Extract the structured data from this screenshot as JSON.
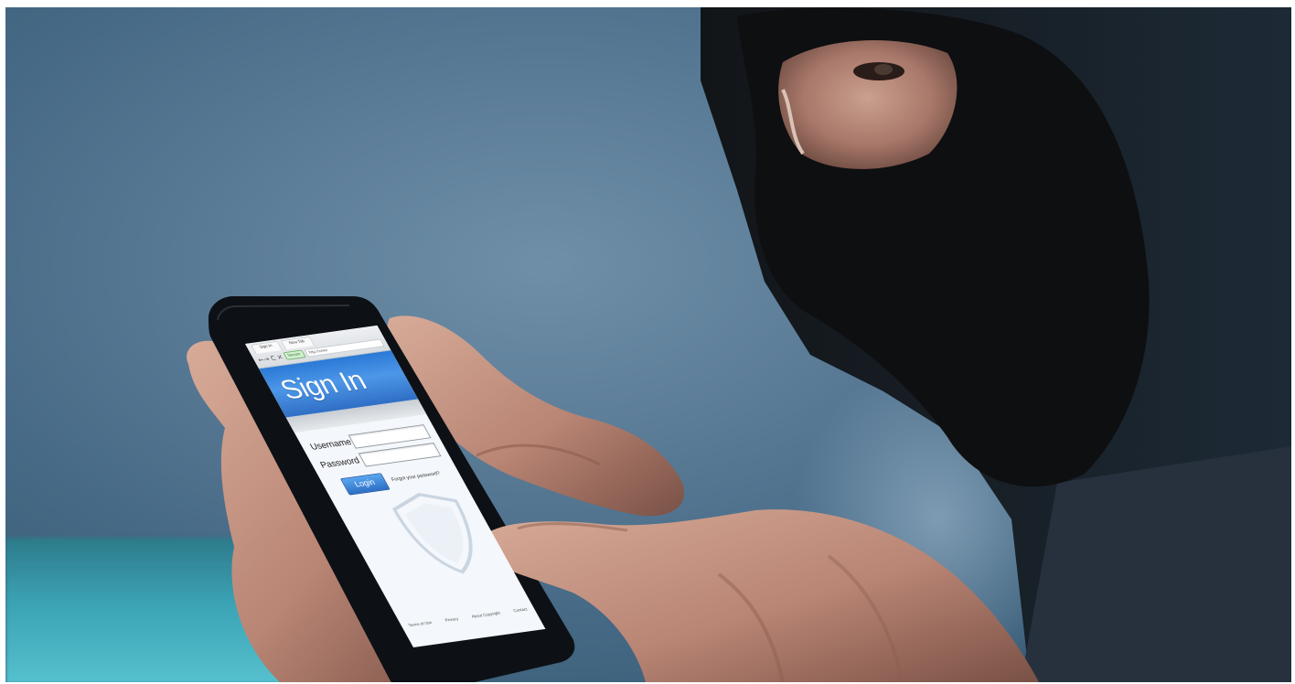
{
  "phone_screen": {
    "tabs": [
      "Sign In",
      "New Tab"
    ],
    "secure_badge": "Secure",
    "url": "http://www",
    "heading": "Sign In",
    "username_label": "Username",
    "password_label": "Password",
    "login_button": "Login",
    "forgot_link": "Forgot your password?",
    "footer_links": [
      "Terms of Use",
      "Privacy",
      "About Copyright",
      "Contact"
    ]
  },
  "colors": {
    "background": "#4a6d88",
    "banner_blue": "#2f7ad8",
    "floor_teal": "#3ba3b4",
    "balaclava": "#0d0d0f",
    "skin": "#b58472"
  },
  "icon_names": {
    "shield": "shield-icon",
    "back_forward": "back-forward-arrows-icon"
  }
}
